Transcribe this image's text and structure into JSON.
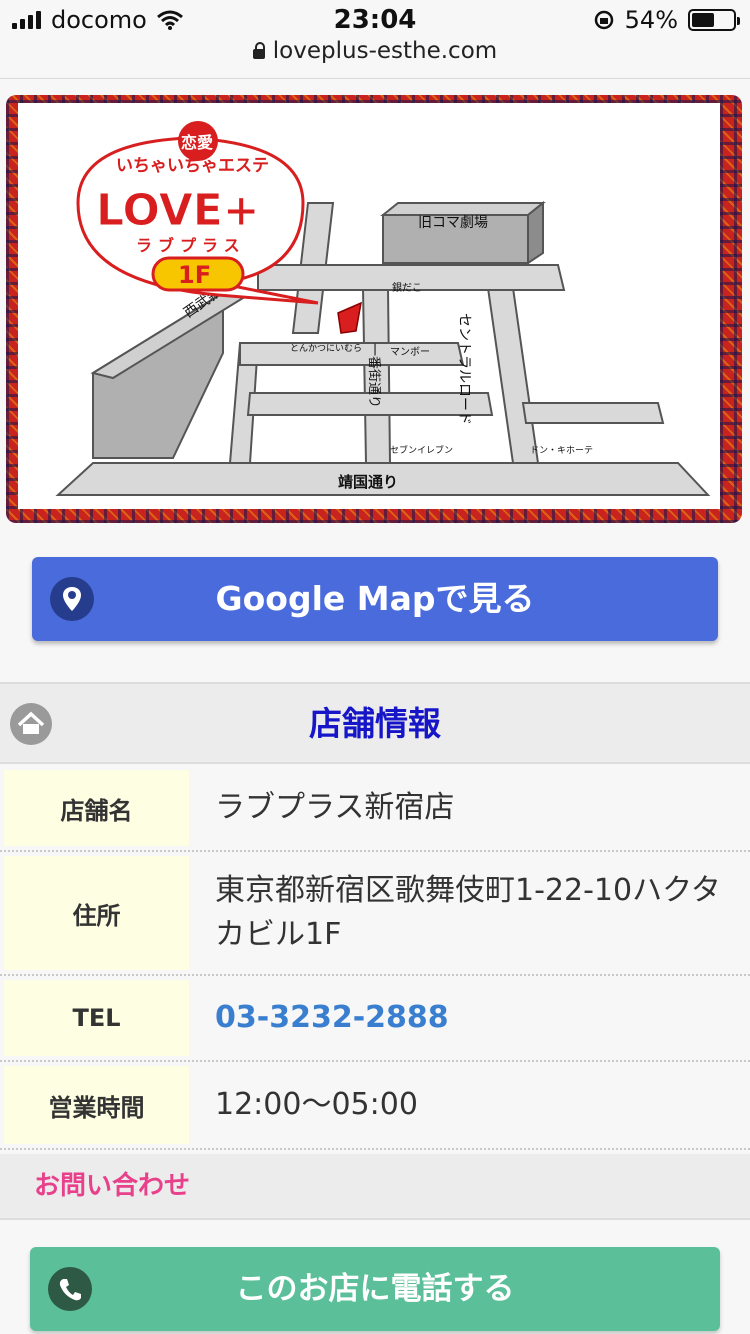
{
  "status_bar": {
    "carrier": "docomo",
    "time": "23:04",
    "battery": "54%",
    "battery_level": 0.54
  },
  "browser": {
    "url": "loveplus-esthe.com"
  },
  "map": {
    "logo_top": "いちゃいちゃエステ",
    "logo_badge": "恋愛",
    "logo_main": "LOVE+",
    "logo_kana": "ラブプラス",
    "floor": "1F",
    "labels": {
      "old_koma": "旧コマ劇場",
      "seibu": "西武新宿駅",
      "central_road": "セントラルロード",
      "ichibangai": "一番街通り",
      "yasukuni": "靖国通り",
      "ginadako": "銀だこ",
      "manbo": "マンボー",
      "tonkatsu": "とんかつにいむら",
      "seven": "セブンイレブン",
      "donki": "ドン・キホーテ"
    }
  },
  "buttons": {
    "google_map": "Google Mapで見る",
    "call": "このお店に電話する"
  },
  "store_info": {
    "title": "店舗情報",
    "rows": [
      {
        "label": "店舗名",
        "value": "ラブプラス新宿店"
      },
      {
        "label": "住所",
        "value": "東京都新宿区歌舞伎町1-22-10ハクタカビル1F"
      },
      {
        "label": "TEL",
        "value": "03-3232-2888"
      },
      {
        "label": "営業時間",
        "value": "12:00〜05:00"
      }
    ]
  },
  "contact": {
    "title": "お問い合わせ"
  },
  "colors": {
    "map_button": "#4a6bdc",
    "call_button": "#5bbf99",
    "section_title": "#1616c8",
    "contact_title": "#e8408a",
    "tel_link": "#3a7fcf"
  }
}
